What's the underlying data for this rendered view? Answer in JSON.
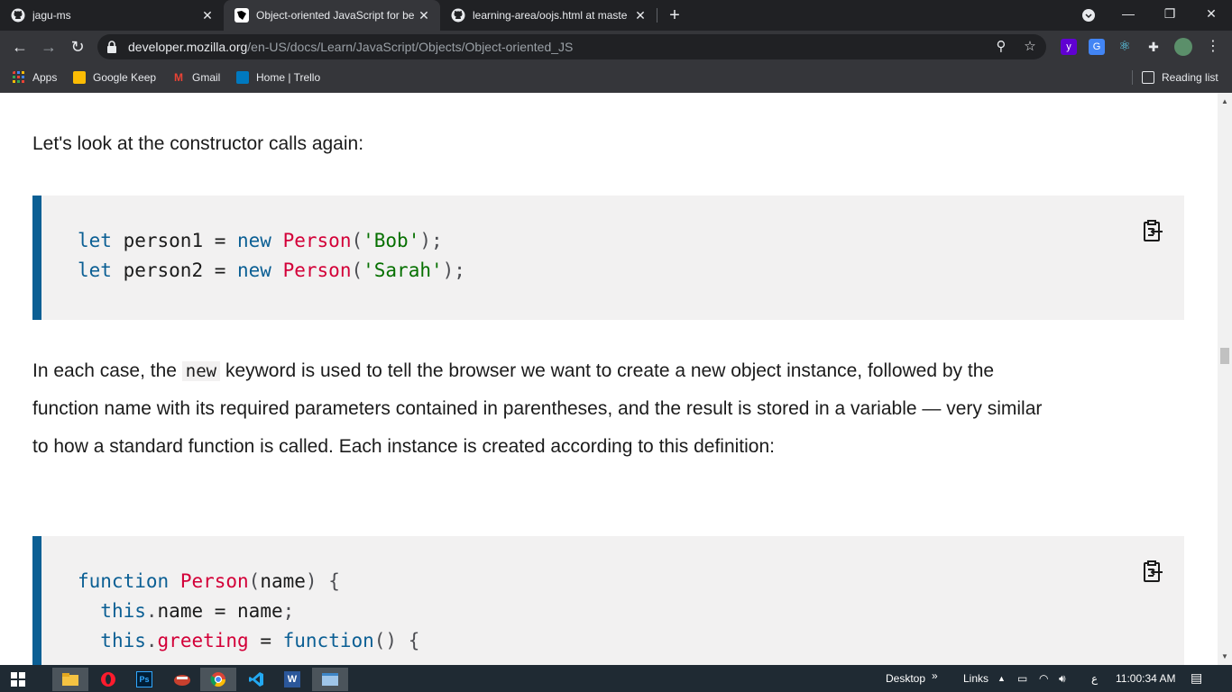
{
  "browser": {
    "tabs": [
      {
        "title": "jagu-ms",
        "icon": "github-icon"
      },
      {
        "title": "Object-oriented JavaScript for be",
        "icon": "mdn-icon"
      },
      {
        "title": "learning-area/oojs.html at maste",
        "icon": "github-icon"
      }
    ],
    "url_host": "developer.mozilla.org",
    "url_path": "/en-US/docs/Learn/JavaScript/Objects/Object-oriented_JS",
    "bookmarks": [
      {
        "label": "Apps",
        "icon": "apps-grid-icon"
      },
      {
        "label": "Google Keep",
        "icon": "keep-icon"
      },
      {
        "label": "Gmail",
        "icon": "gmail-icon"
      },
      {
        "label": "Home | Trello",
        "icon": "trello-icon"
      }
    ],
    "reading_list": "Reading list"
  },
  "content": {
    "para1": "Let's look at the constructor calls again:",
    "code1": [
      {
        "tokens": [
          [
            "let",
            "kw"
          ],
          [
            " person1 = ",
            ""
          ],
          [
            "new",
            "kw"
          ],
          [
            " ",
            ""
          ],
          [
            "Person",
            "fn"
          ],
          [
            "(",
            "pn"
          ],
          [
            "'Bob'",
            "str"
          ],
          [
            ");",
            "pn"
          ]
        ]
      },
      {
        "tokens": [
          [
            "let",
            "kw"
          ],
          [
            " person2 = ",
            ""
          ],
          [
            "new",
            "kw"
          ],
          [
            " ",
            ""
          ],
          [
            "Person",
            "fn"
          ],
          [
            "(",
            "pn"
          ],
          [
            "'Sarah'",
            "str"
          ],
          [
            ");",
            "pn"
          ]
        ]
      }
    ],
    "para2_before": "In each case, the ",
    "para2_code": "new",
    "para2_after": " keyword is used to tell the browser we want to create a new object instance, followed by the function name with its required parameters contained in parentheses, and the result is stored in a variable — very similar to how a standard function is called. Each instance is created according to this definition:",
    "code2": [
      {
        "tokens": [
          [
            "function",
            "kw"
          ],
          [
            " ",
            ""
          ],
          [
            "Person",
            "fn"
          ],
          [
            "(",
            "pn"
          ],
          [
            "name",
            ""
          ],
          [
            ") {",
            "pn"
          ]
        ]
      },
      {
        "tokens": [
          [
            "  ",
            ""
          ],
          [
            "this",
            "kw"
          ],
          [
            ".",
            "pn"
          ],
          [
            "name",
            ""
          ],
          [
            " = name",
            ""
          ],
          [
            ";",
            "pn"
          ]
        ]
      },
      {
        "tokens": [
          [
            "  ",
            ""
          ],
          [
            "this",
            "kw"
          ],
          [
            ".",
            "pn"
          ],
          [
            "greeting",
            "fn"
          ],
          [
            " = ",
            ""
          ],
          [
            "function",
            "kw"
          ],
          [
            "() {",
            "pn"
          ]
        ]
      }
    ]
  },
  "taskbar": {
    "desktop_label": "Desktop",
    "links_label": "Links",
    "clock": "11:00:34 AM",
    "lang": "ع"
  },
  "colors": {
    "code_border": "#0b5f94",
    "keyword": "#0b5f94",
    "function_name": "#d30038",
    "string": "#067000",
    "code_bg": "#f2f1f1"
  }
}
